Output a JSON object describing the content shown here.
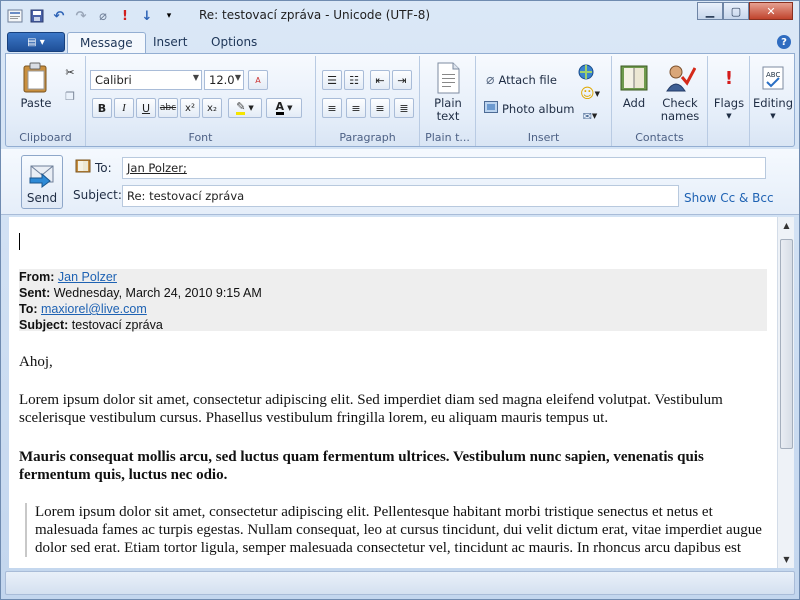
{
  "window": {
    "title": "Re: testovací zpráva - Unicode (UTF-8)"
  },
  "tabs": [
    {
      "label": "Message"
    },
    {
      "label": "Insert"
    },
    {
      "label": "Options"
    }
  ],
  "ribbon": {
    "clipboard": {
      "group_label": "Clipboard",
      "paste_label": "Paste"
    },
    "font": {
      "group_label": "Font",
      "family": "Calibri",
      "size": "12.0"
    },
    "paragraph": {
      "group_label": "Paragraph"
    },
    "plaintext": {
      "group_label": "Plain t...",
      "button_label_1": "Plain",
      "button_label_2": "text"
    },
    "insert": {
      "group_label": "Insert",
      "attach_label": "Attach file",
      "photo_label": "Photo album"
    },
    "contacts": {
      "group_label": "Contacts",
      "add_label": "Add",
      "check_label_1": "Check",
      "check_label_2": "names"
    },
    "flags": {
      "label": "Flags"
    },
    "editing": {
      "label": "Editing"
    }
  },
  "compose": {
    "send_label": "Send",
    "to_label": "To:",
    "to_value": "Jan Polzer;",
    "subject_label": "Subject:",
    "subject_value": "Re: testovací zpráva",
    "show_cc_label": "Show Cc & Bcc"
  },
  "message": {
    "quoted_header": {
      "from_label": "From:",
      "from_value": "Jan Polzer",
      "sent_label": "Sent:",
      "sent_value": "Wednesday, March 24, 2010 9:15 AM",
      "to_label": "To:",
      "to_value": "maxiorel@live.com",
      "subject_label": "Subject:",
      "subject_value": "testovací zpráva"
    },
    "greeting": "Ahoj,",
    "para1": "Lorem ipsum dolor sit amet, consectetur adipiscing elit. Sed imperdiet diam sed magna eleifend volutpat. Vestibulum scelerisque vestibulum cursus. Phasellus vestibulum fringilla lorem, eu aliquam mauris tempus ut.",
    "para2": "Mauris consequat mollis arcu, sed luctus quam fermentum ultrices. Vestibulum nunc sapien, venenatis quis fermentum quis, luctus nec odio.",
    "para3": "Lorem ipsum dolor sit amet, consectetur adipiscing elit. Pellentesque habitant morbi tristique senectus et netus et malesuada fames ac turpis egestas. Nullam consequat, leo at cursus tincidunt, dui velit dictum erat, vitae imperdiet augue dolor sed erat. Etiam tortor ligula, semper malesuada consectetur vel, tincidunt ac mauris. In rhoncus arcu dapibus est"
  }
}
